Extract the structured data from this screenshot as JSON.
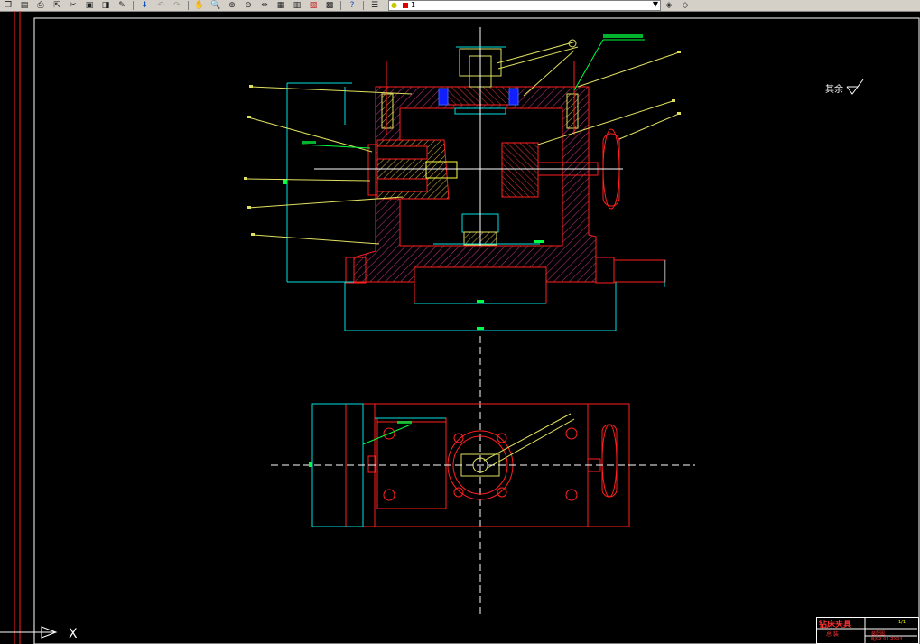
{
  "toolbar": {
    "icons": [
      "copy-icon",
      "properties-icon",
      "print-icon",
      "publish-icon",
      "cut-icon",
      "paste-icon",
      "match-icon",
      "brush-icon",
      "arrow-down-icon",
      "undo-icon",
      "redo-icon",
      "pan-icon",
      "zoom-realtime-icon",
      "zoom-window-icon",
      "zoom-previous-icon",
      "distance-icon",
      "properties-palette-icon",
      "design-center-icon",
      "tool-palette-icon",
      "calculator-icon",
      "help-icon",
      "layer-manager-icon",
      "layer-state-icon"
    ],
    "current_layer": "1",
    "current_layer_color": "#e00000"
  },
  "drawing": {
    "roughness_symbol": "其余",
    "colors": {
      "outline": "#ff2020",
      "hatch": "#b03078",
      "dimension": "#00e0e0",
      "leader": "#e0e060",
      "centerline": "#ffffff",
      "annotation": "#00ff40"
    }
  },
  "title_block": {
    "title": "钻床夹具",
    "subtitle": "总 装",
    "sub2": "装配图",
    "code": "BJ02-04-ZX04",
    "page": "1/1"
  },
  "ucs": {
    "x_label": "X"
  }
}
